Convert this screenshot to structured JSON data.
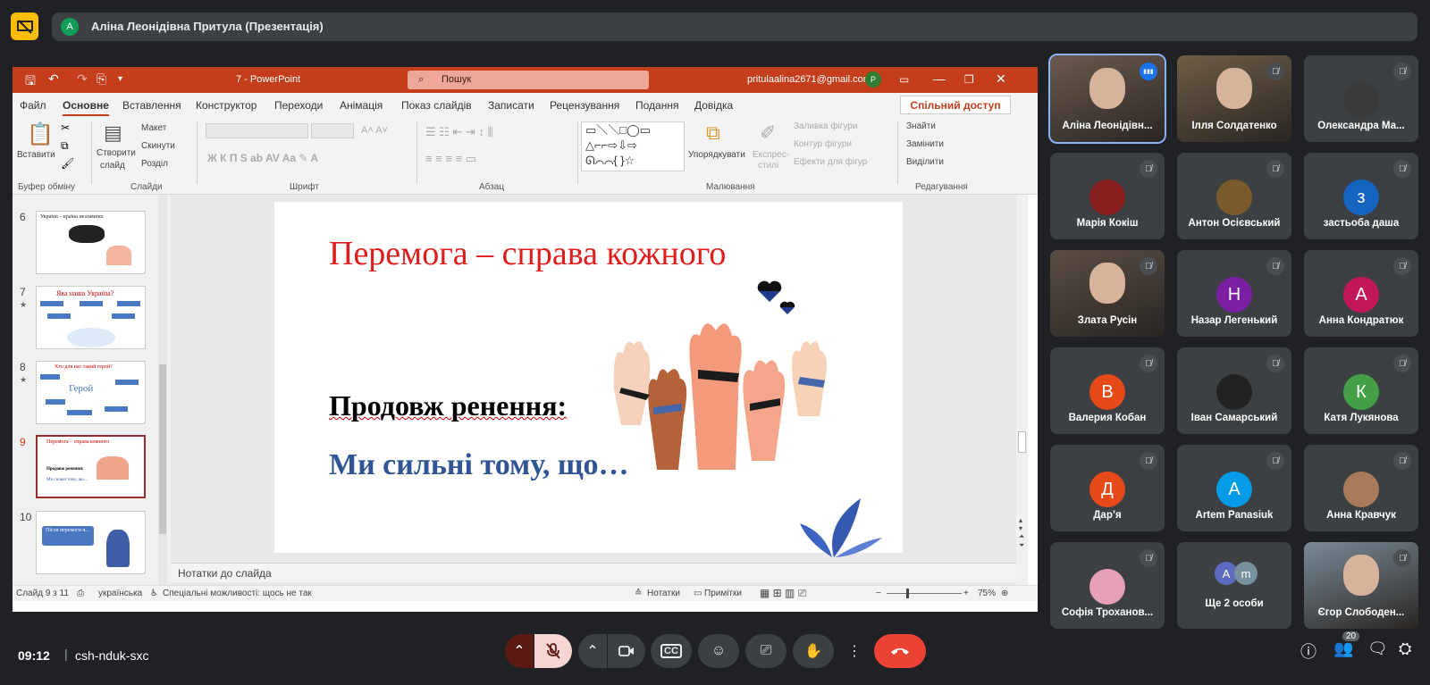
{
  "meet": {
    "presenter_initial": "А",
    "presenter_title": "Аліна Леонідівна Притула (Презентація)",
    "time": "09:12",
    "meeting_code": "csh-nduk-sxc",
    "participants_count": "20",
    "participants": [
      {
        "name": "Аліна Леонідівн...",
        "avatar": "",
        "color": "#6b5a4f",
        "video": true
      },
      {
        "name": "Ілля Солдатенко",
        "avatar": "",
        "color": "#6e5d46",
        "video": true
      },
      {
        "name": "Олександра Ма...",
        "avatar": "",
        "color": "#3a3a3a",
        "video": false
      },
      {
        "name": "Марія Кокіш",
        "avatar": "",
        "color": "#8a1f1f",
        "video": false
      },
      {
        "name": "Антон Осієвський",
        "avatar": "",
        "color": "#7a5a2a",
        "video": false
      },
      {
        "name": "застьоба даша",
        "avatar": "з",
        "color": "#1565c0",
        "video": false
      },
      {
        "name": "Злата Русін",
        "avatar": "",
        "color": "#5a4e45",
        "video": true
      },
      {
        "name": "Назар Легенький",
        "avatar": "Н",
        "color": "#7b1fa2",
        "video": false
      },
      {
        "name": "Анна Кондратюк",
        "avatar": "А",
        "color": "#c2185b",
        "video": false
      },
      {
        "name": "Валерия Кобан",
        "avatar": "В",
        "color": "#e64a19",
        "video": false
      },
      {
        "name": "Іван Самарський",
        "avatar": "",
        "color": "#222222",
        "video": false
      },
      {
        "name": "Катя Лукянова",
        "avatar": "К",
        "color": "#43a047",
        "video": false
      },
      {
        "name": "Дар’я",
        "avatar": "Д",
        "color": "#e64a19",
        "video": false
      },
      {
        "name": "Artem Panasiuk",
        "avatar": "А",
        "color": "#039be5",
        "video": false
      },
      {
        "name": "Анна Кравчук",
        "avatar": "",
        "color": "#a87a5a",
        "video": false
      },
      {
        "name": "Софія Троханов...",
        "avatar": "",
        "color": "#e8a0b8",
        "video": false
      },
      {
        "name": "Ще 2 особи",
        "avatar": "",
        "color": "#5c6bc0",
        "video": false
      },
      {
        "name": "Єгор Слободен...",
        "avatar": "",
        "color": "#7a8a96",
        "video": true
      }
    ]
  },
  "ppt": {
    "title": "7  -  PowerPoint",
    "search_placeholder": "Пошук",
    "email": "pritulaalina2671@gmail.com",
    "user_initial": "P",
    "tabs": [
      "Файл",
      "Основне",
      "Вставлення",
      "Конструктор",
      "Переходи",
      "Анімація",
      "Показ слайдів",
      "Записати",
      "Рецензування",
      "Подання",
      "Довідка"
    ],
    "share": "Спільний доступ",
    "ribbon": {
      "paste": "Вставити",
      "clipboard": "Буфер обміну",
      "new_slide_1": "Створити",
      "new_slide_2": "слайд",
      "layout": "Макет",
      "reset": "Скинути",
      "section": "Розділ",
      "slides": "Слайди",
      "font": "Шрифт",
      "paragraph": "Абзац",
      "arrange": "Упорядкувати",
      "express": "Експрес-",
      "styles": "стилі",
      "fill": "Заливка фігури",
      "outline": "Контур фігури",
      "effects": "Ефекти для фігур",
      "drawing": "Малювання",
      "find": "Знайти",
      "replace": "Замінити",
      "select": "Виділити",
      "editing": "Редагування"
    },
    "thumbnails": [
      {
        "num": "6",
        "title": "Україна – країна незламних"
      },
      {
        "num": "7",
        "title": "Яка наша Україна?"
      },
      {
        "num": "8",
        "title": "Хто для нас такий герой?"
      },
      {
        "num": "9",
        "title": "Перемога – справа кожного"
      },
      {
        "num": "10",
        "title": "Після перемоги я..."
      }
    ],
    "slide": {
      "title": "Перемога – справа кожного",
      "subtitle": "Продовж ренення:",
      "body": "Ми сильні тому, що…"
    },
    "notes": "Нотатки до слайда",
    "status": {
      "slide": "Слайд 9 з 11",
      "lang": "українська",
      "accessibility": "Спеціальні можливості: щось не так",
      "notes_btn": "Нотатки",
      "comments_btn": "Примітки",
      "zoom": "75%"
    }
  }
}
